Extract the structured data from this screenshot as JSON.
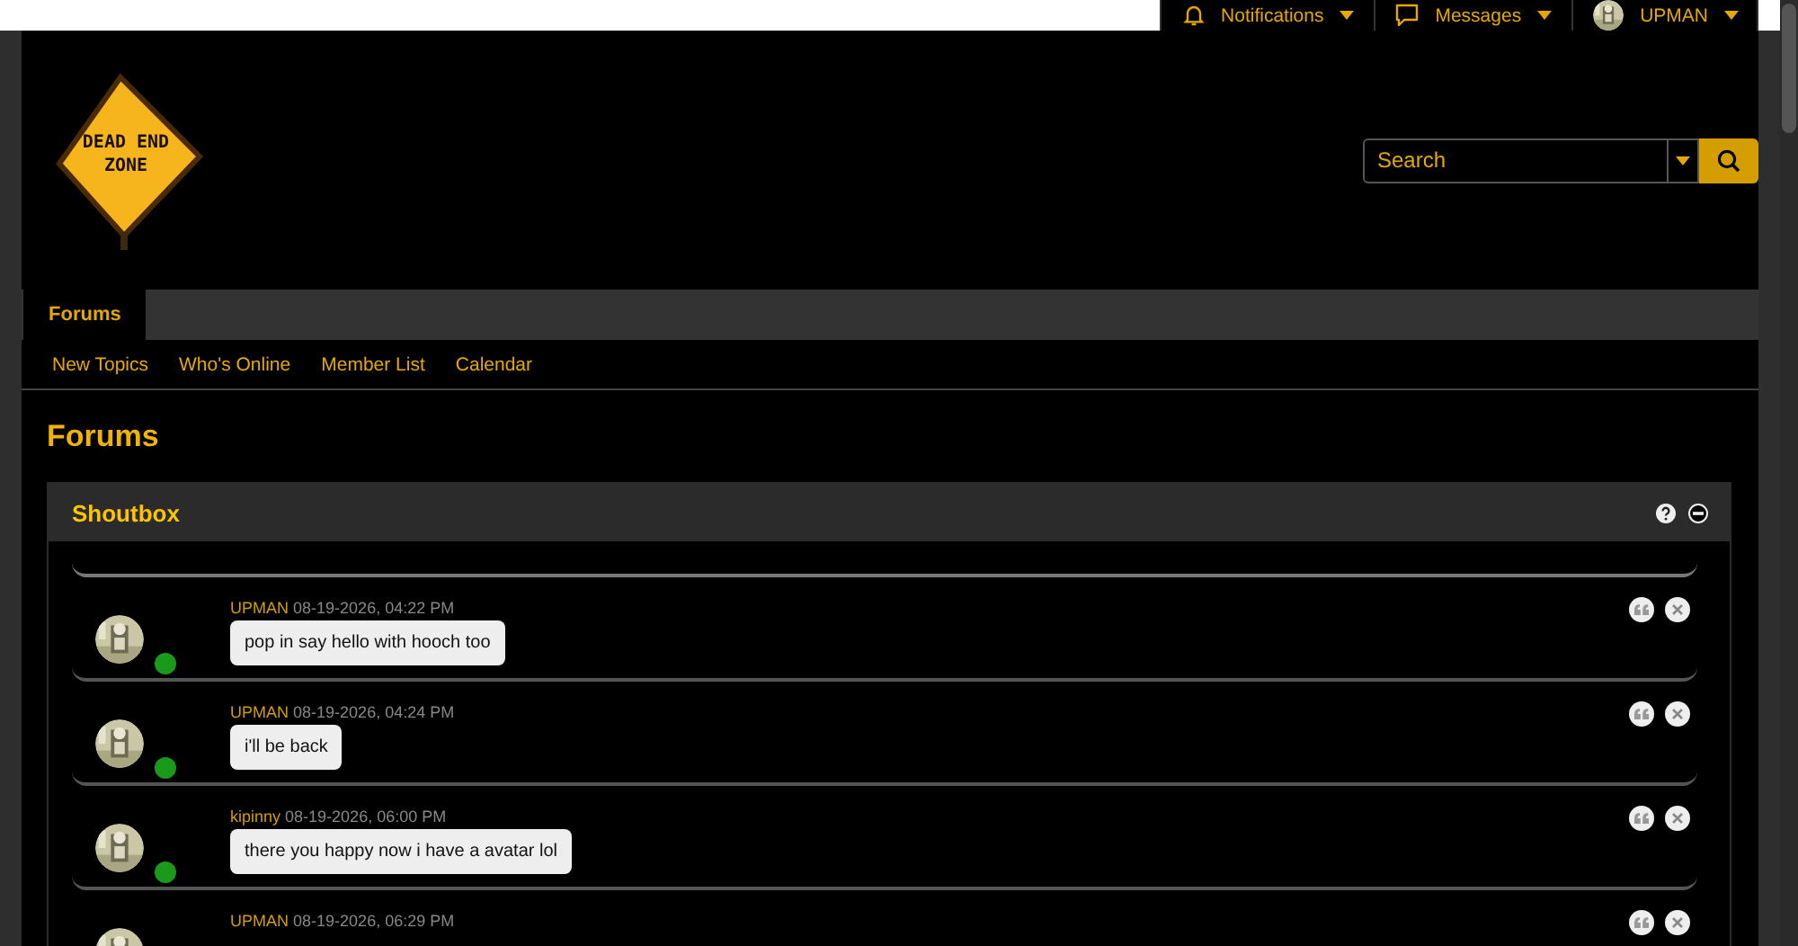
{
  "user_nav": [
    {
      "kind": "bell",
      "label": "Notifications"
    },
    {
      "kind": "chat",
      "label": "Messages"
    },
    {
      "kind": "avatar",
      "label": "UPMAN"
    }
  ],
  "logo": {
    "lines": [
      "DEAD END",
      "ZONE"
    ]
  },
  "search": {
    "placeholder": "Search"
  },
  "tabs": [
    {
      "label": "Forums",
      "selected": true
    }
  ],
  "subnav": [
    "New Topics",
    "Who's Online",
    "Member List",
    "Calendar"
  ],
  "page_title": "Forums",
  "shoutbox": {
    "title": "Shoutbox",
    "messages": [
      {
        "author": "UPMAN",
        "time": "08-19-2026, 04:22 PM",
        "text": "pop in say hello with hooch too",
        "online": true
      },
      {
        "author": "UPMAN",
        "time": "08-19-2026, 04:24 PM",
        "text": "i'll be back",
        "online": true
      },
      {
        "author": "kipinny",
        "time": "08-19-2026, 06:00 PM",
        "text": "there you happy now i have a avatar lol",
        "online": true
      },
      {
        "author": "UPMAN",
        "time": "08-19-2026, 06:29 PM"
      }
    ]
  }
}
